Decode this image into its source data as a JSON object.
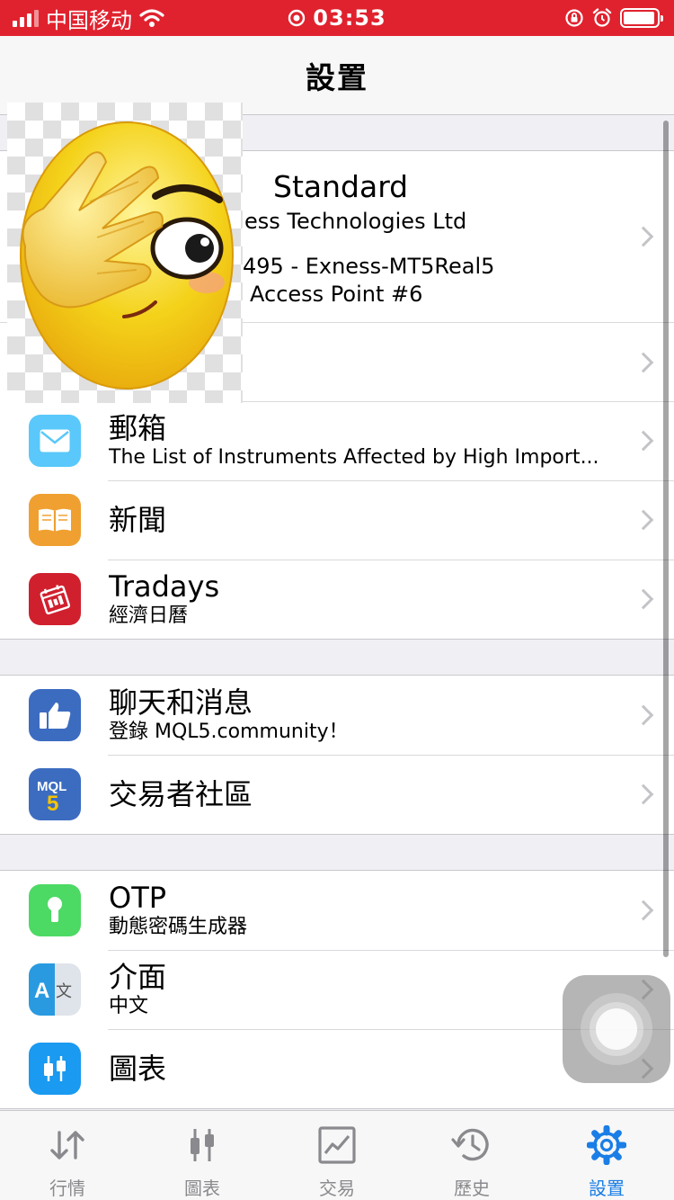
{
  "status_bar": {
    "carrier": "中国移动",
    "time": "03:53"
  },
  "nav": {
    "title": "設置"
  },
  "account": {
    "name": "Standard",
    "company": "ess Technologies Ltd",
    "server": "495 - Exness-MT5Real5",
    "access_point": "Access Point #6"
  },
  "items": [
    {
      "id": "mailbox",
      "title": "郵箱",
      "subtitle": "The List of Instruments Affected by High Import...",
      "icon": "envelope-icon",
      "color": "#5ac8fa"
    },
    {
      "id": "news",
      "title": "新聞",
      "subtitle": "",
      "icon": "book-icon",
      "color": "#f0a030"
    },
    {
      "id": "tradays",
      "title": "Tradays",
      "subtitle": "經濟日曆",
      "icon": "calendar-icon",
      "color": "#d0202e"
    },
    {
      "id": "chat",
      "title": "聊天和消息",
      "subtitle": "登錄 MQL5.community！",
      "icon": "thumbs-up-icon",
      "color": "#3c6cc0"
    },
    {
      "id": "community",
      "title": "交易者社區",
      "subtitle": "",
      "icon": "mql5-icon",
      "color": "#3c6cc0"
    },
    {
      "id": "otp",
      "title": "OTP",
      "subtitle": "動態密碼生成器",
      "icon": "keyhole-icon",
      "color": "#4cd964"
    },
    {
      "id": "interface",
      "title": "介面",
      "subtitle": "中文",
      "icon": "translate-icon",
      "color": "#2a9ae0"
    },
    {
      "id": "charts",
      "title": "圖表",
      "subtitle": "",
      "icon": "candlestick-icon",
      "color": "#1a9af0"
    }
  ],
  "tabs": [
    {
      "label": "行情",
      "icon": "quotes-arrows-icon",
      "active": false
    },
    {
      "label": "圖表",
      "icon": "chart-candles-icon",
      "active": false
    },
    {
      "label": "交易",
      "icon": "trade-chart-icon",
      "active": false
    },
    {
      "label": "歷史",
      "icon": "history-clock-icon",
      "active": false
    },
    {
      "label": "設置",
      "icon": "gear-icon",
      "active": true
    }
  ]
}
